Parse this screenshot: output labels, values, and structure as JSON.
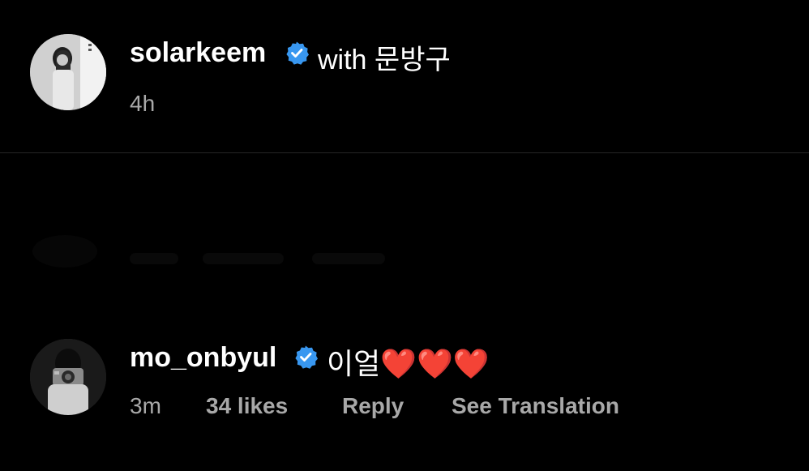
{
  "post": {
    "username": "solarkeem",
    "with_text": "with 문방구",
    "time": "4h",
    "avatar_icon": "avatar-solarkeem",
    "verified_icon": "verified-badge-icon",
    "verified_color": "#3897f0"
  },
  "comment": {
    "username": "mo_onbyul",
    "text": "이얼❤️❤️❤️",
    "time": "3m",
    "likes": "34 likes",
    "reply_label": "Reply",
    "translate_label": "See Translation",
    "avatar_icon": "avatar-mo_onbyul",
    "verified_icon": "verified-badge-icon"
  },
  "colors": {
    "background": "#000000",
    "primary_text": "#ffffff",
    "secondary_text": "#a8a8a8",
    "divider": "#262626"
  }
}
